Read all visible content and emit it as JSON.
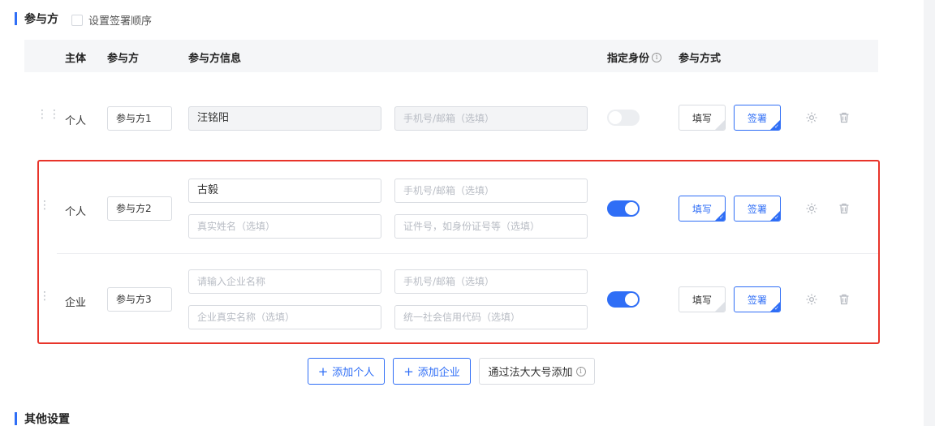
{
  "section": {
    "title": "参与方",
    "order_checkbox_label": "设置签署顺序"
  },
  "table": {
    "headers": {
      "subject": "主体",
      "party": "参与方",
      "party_info": "参与方信息",
      "designate_identity": "指定身份",
      "participation_mode": "参与方式"
    }
  },
  "rows": [
    {
      "subject": "个人",
      "party": "参与方1",
      "name_value": "汪铭阳",
      "contact_placeholder": "手机号/邮箱（选填）",
      "designate_on": false,
      "mode_fill": "填写",
      "mode_sign": "签署"
    },
    {
      "subject": "个人",
      "party": "参与方2",
      "name_value": "古毅",
      "contact_placeholder": "手机号/邮箱（选填）",
      "realname_placeholder": "真实姓名（选填）",
      "id_placeholder": "证件号，如身份证号等（选填）",
      "designate_on": true,
      "mode_fill": "填写",
      "mode_sign": "签署"
    },
    {
      "subject": "企业",
      "party": "参与方3",
      "company_placeholder": "请输入企业名称",
      "contact_placeholder": "手机号/邮箱（选填）",
      "company_realname_placeholder": "企业真实名称（选填）",
      "credit_code_placeholder": "统一社会信用代码（选填）",
      "designate_on": true,
      "mode_fill": "填写",
      "mode_sign": "签署"
    }
  ],
  "actions": {
    "add_person": "添加个人",
    "add_company": "添加企业",
    "add_via_fadada": "通过法大大号添加"
  },
  "next_section": {
    "title": "其他设置"
  },
  "colors": {
    "accent": "#2f6ef6",
    "highlight_border": "#e8342a"
  }
}
